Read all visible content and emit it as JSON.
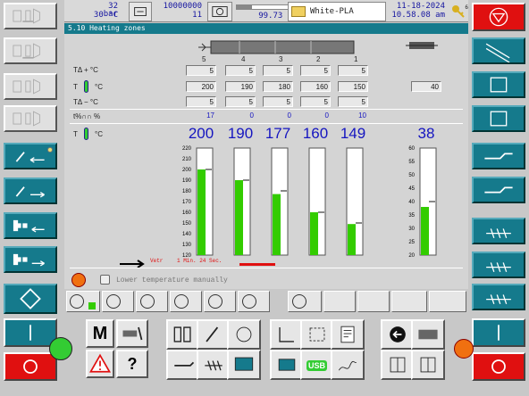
{
  "header": {
    "pressure": "32 bar",
    "temperature": "30 °C",
    "counter_top": "10000000",
    "counter_bottom": "11",
    "cycle_time": "99.73 sec",
    "material": "White-PLA",
    "date": "11-18-2024",
    "time": "10.58.08 am",
    "level_label": "6",
    "progress_fraction": 0.25
  },
  "screen_title": "5.10 Heating zones",
  "zones": {
    "numbers": [
      "5",
      "4",
      "3",
      "2",
      "1"
    ],
    "row_labels": {
      "tol_plus": "TΔ + °C",
      "setpoint": "T",
      "setpoint_unit": "°C",
      "tol_minus": "TΔ − °C",
      "output": "t%∩∩ %",
      "actual": "T",
      "actual_unit": "°C"
    },
    "tol_plus": [
      "5",
      "5",
      "5",
      "5",
      "5"
    ],
    "setpoint": [
      "200",
      "190",
      "180",
      "160",
      "150"
    ],
    "tol_minus": [
      "5",
      "5",
      "5",
      "5",
      "5"
    ],
    "output": [
      "17",
      "0",
      "0",
      "0",
      "10"
    ],
    "actual": [
      "200",
      "190",
      "177",
      "160",
      "149"
    ]
  },
  "oil": {
    "setpoint": "40",
    "actual": "38"
  },
  "scale_main": [
    "220",
    "210",
    "200",
    "190",
    "180",
    "170",
    "160",
    "150",
    "140",
    "130",
    "120"
  ],
  "scale_oil": [
    "60",
    "55",
    "50",
    "45",
    "40",
    "35",
    "30",
    "25",
    "20"
  ],
  "bar_values": [
    200,
    190,
    177,
    160,
    149
  ],
  "bar_setpoints": [
    200,
    190,
    180,
    160,
    150
  ],
  "oil_value": 38,
  "status": {
    "label": "Vetr",
    "timer": "1 Min. 24 Sec."
  },
  "lower_manually": "Lower temperature manually",
  "bottom": {
    "m_label": "M",
    "q_label": "?",
    "usb_label": "USB"
  },
  "colors": {
    "teal": "#157a8c",
    "green": "#33cc00",
    "blue": "#1515c0",
    "red": "#e01010"
  }
}
